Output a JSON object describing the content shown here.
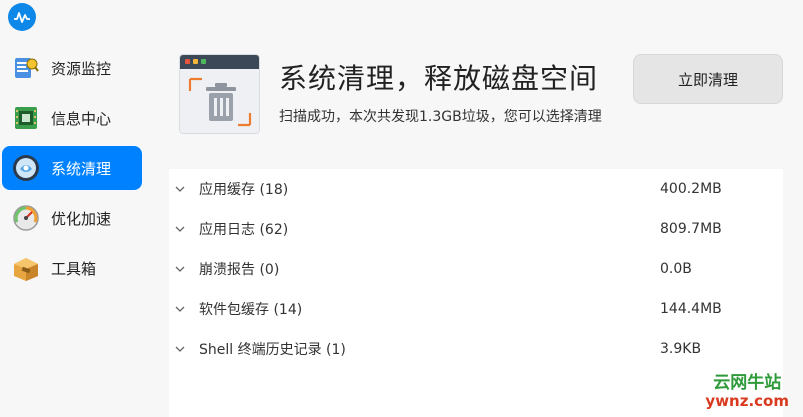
{
  "app": {
    "logo_icon": "waveform-logo-icon"
  },
  "titlebar": {
    "menu_icon": "hamburger-menu-icon",
    "minimize_icon": "minimize-icon",
    "maximize_icon": "maximize-icon",
    "close_icon": "close-icon"
  },
  "sidebar": {
    "items": [
      {
        "label": "资源监控",
        "icon": "resource-monitor-icon",
        "active": false
      },
      {
        "label": "信息中心",
        "icon": "info-center-icon",
        "active": false
      },
      {
        "label": "系统清理",
        "icon": "system-clean-icon",
        "active": true
      },
      {
        "label": "优化加速",
        "icon": "speedometer-icon",
        "active": false
      },
      {
        "label": "工具箱",
        "icon": "toolbox-icon",
        "active": false
      }
    ]
  },
  "main": {
    "hero_icon": "trash-window-icon",
    "headline": "系统清理，释放磁盘空间",
    "subline": "扫描成功，本次共发现1.3GB垃圾，您可以选择清理",
    "clean_button": "立即清理",
    "rows": [
      {
        "label": "应用缓存 (18)",
        "size": "400.2MB"
      },
      {
        "label": "应用日志 (62)",
        "size": "809.7MB"
      },
      {
        "label": "崩溃报告 (0)",
        "size": "0.0B"
      },
      {
        "label": "软件包缓存 (14)",
        "size": "144.4MB"
      },
      {
        "label": "Shell 终端历史记录 (1)",
        "size": "3.9KB"
      }
    ]
  },
  "watermark": {
    "top": "云网牛站",
    "bottom": "ywnz.com"
  },
  "colors": {
    "accent": "#0081ff",
    "sidebar_bg": "#f7f7f7",
    "button_bg": "#e5e5e5"
  }
}
